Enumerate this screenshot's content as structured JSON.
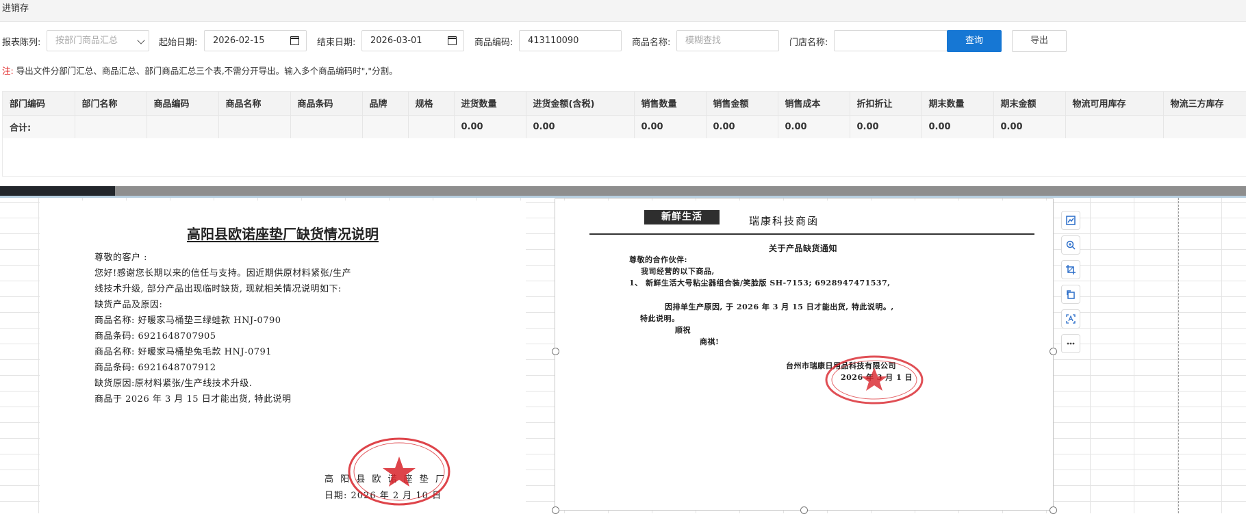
{
  "app": {
    "title": "进销存"
  },
  "filters": {
    "report_type_label": "报表陈列:",
    "report_type_value": "按部门商品汇总",
    "start_date_label": "起始日期:",
    "start_date_value": "2026-02-15",
    "end_date_label": "结束日期:",
    "end_date_value": "2026-03-01",
    "product_code_label": "商品编码:",
    "product_code_value": "413110090",
    "product_name_label": "商品名称:",
    "product_name_placeholder": "模糊查找",
    "store_name_label": "门店名称:",
    "store_name_value": "",
    "query_button": "查询",
    "export_button": "导出"
  },
  "note": {
    "prefix": "注:",
    "text": "导出文件分部门汇总、商品汇总、部门商品汇总三个表,不需分开导出。输入多个商品编码时\",\"分割。"
  },
  "table": {
    "columns": [
      "部门编码",
      "部门名称",
      "商品编码",
      "商品名称",
      "商品条码",
      "品牌",
      "规格",
      "进货数量",
      "进货金额(含税)",
      "销售数量",
      "销售金额",
      "销售成本",
      "折扣折让",
      "期末数量",
      "期末金额",
      "物流可用库存",
      "物流三方库存"
    ],
    "total_row": [
      "合计:",
      "",
      "",
      "",
      "",
      "",
      "",
      "0.00",
      "0.00",
      "0.00",
      "0.00",
      "0.00",
      "0.00",
      "0.00",
      "0.00",
      "",
      ""
    ]
  },
  "doc1": {
    "title": "高阳县欧诺座垫厂缺货情况说明",
    "lines": [
      "尊敬的客户 :",
      "您好!感谢您长期以来的信任与支持。因近期供原材料紧张/生产",
      "线技术升级, 部分产品出现临时缺货, 现就相关情况说明如下:",
      "缺货产品及原因:",
      "商品名称: 好暖家马桶垫三绿蛙款 HNJ-0790",
      "商品条码: 6921648707905",
      "商品名称: 好暖家马桶垫兔毛款 HNJ-0791",
      "商品条码: 6921648707912",
      "缺货原因:原材料紧张/生产线技术升级.",
      "商品于 2026 年 3 月 15 日才能出货, 特此说明"
    ],
    "signature_company": "高 阳 县 欧 诺 座 垫 厂",
    "signature_date": "日期: 2026 年 2 月 10 日",
    "stamp_text": "高阳县欧诺座垫厂"
  },
  "doc2": {
    "logo": "新鲜生活",
    "letterhead": "瑞康科技商函",
    "title": "关于产品缺货通知",
    "lines": [
      "尊敬的合作伙伴:",
      "我司经营的以下商品,",
      "1、 新鲜生活大号粘尘器组合装/笑脸版 SH-7153; 6928947471537,",
      "因排单生产原因, 于 2026 年 3 月 15 日才能出货, 特此说明。,",
      "特此说明。",
      "顺祝",
      "商祺!"
    ],
    "company": "台州市瑞康日用品科技有限公司",
    "date": "2026 年 3 月 1 日",
    "stamp_text": "台州市瑞康日用品科技有限公司"
  },
  "toolbar_icons": [
    "chart-icon",
    "zoom-in-icon",
    "crop-icon",
    "rotate-icon",
    "ocr-icon",
    "more-icon"
  ],
  "colors": {
    "primary": "#1677d4",
    "stamp_red": "#d8232a",
    "note_red": "#e02020"
  }
}
